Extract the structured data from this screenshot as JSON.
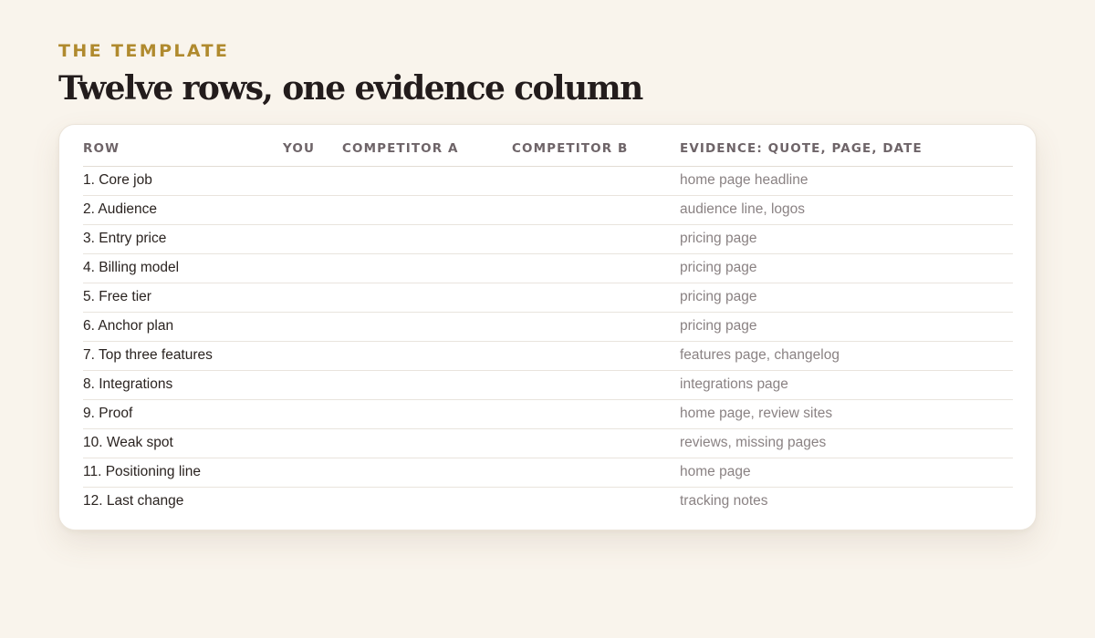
{
  "header": {
    "eyebrow": "THE TEMPLATE",
    "title": "Twelve rows, one evidence column"
  },
  "table": {
    "columns": [
      "ROW",
      "YOU",
      "COMPETITOR A",
      "COMPETITOR B",
      "EVIDENCE: QUOTE, PAGE, DATE"
    ],
    "rows": [
      {
        "label": "1. Core job",
        "you": "",
        "competitor_a": "",
        "competitor_b": "",
        "evidence": "home page headline"
      },
      {
        "label": "2. Audience",
        "you": "",
        "competitor_a": "",
        "competitor_b": "",
        "evidence": "audience line, logos"
      },
      {
        "label": "3. Entry price",
        "you": "",
        "competitor_a": "",
        "competitor_b": "",
        "evidence": "pricing page"
      },
      {
        "label": "4. Billing model",
        "you": "",
        "competitor_a": "",
        "competitor_b": "",
        "evidence": "pricing page"
      },
      {
        "label": "5. Free tier",
        "you": "",
        "competitor_a": "",
        "competitor_b": "",
        "evidence": "pricing page"
      },
      {
        "label": "6. Anchor plan",
        "you": "",
        "competitor_a": "",
        "competitor_b": "",
        "evidence": "pricing page"
      },
      {
        "label": "7. Top three features",
        "you": "",
        "competitor_a": "",
        "competitor_b": "",
        "evidence": "features page, changelog"
      },
      {
        "label": "8. Integrations",
        "you": "",
        "competitor_a": "",
        "competitor_b": "",
        "evidence": "integrations page"
      },
      {
        "label": "9. Proof",
        "you": "",
        "competitor_a": "",
        "competitor_b": "",
        "evidence": "home page, review sites"
      },
      {
        "label": "10. Weak spot",
        "you": "",
        "competitor_a": "",
        "competitor_b": "",
        "evidence": "reviews, missing pages"
      },
      {
        "label": "11. Positioning line",
        "you": "",
        "competitor_a": "",
        "competitor_b": "",
        "evidence": "home page"
      },
      {
        "label": "12. Last change",
        "you": "",
        "competitor_a": "",
        "competitor_b": "",
        "evidence": "tracking notes"
      }
    ]
  }
}
